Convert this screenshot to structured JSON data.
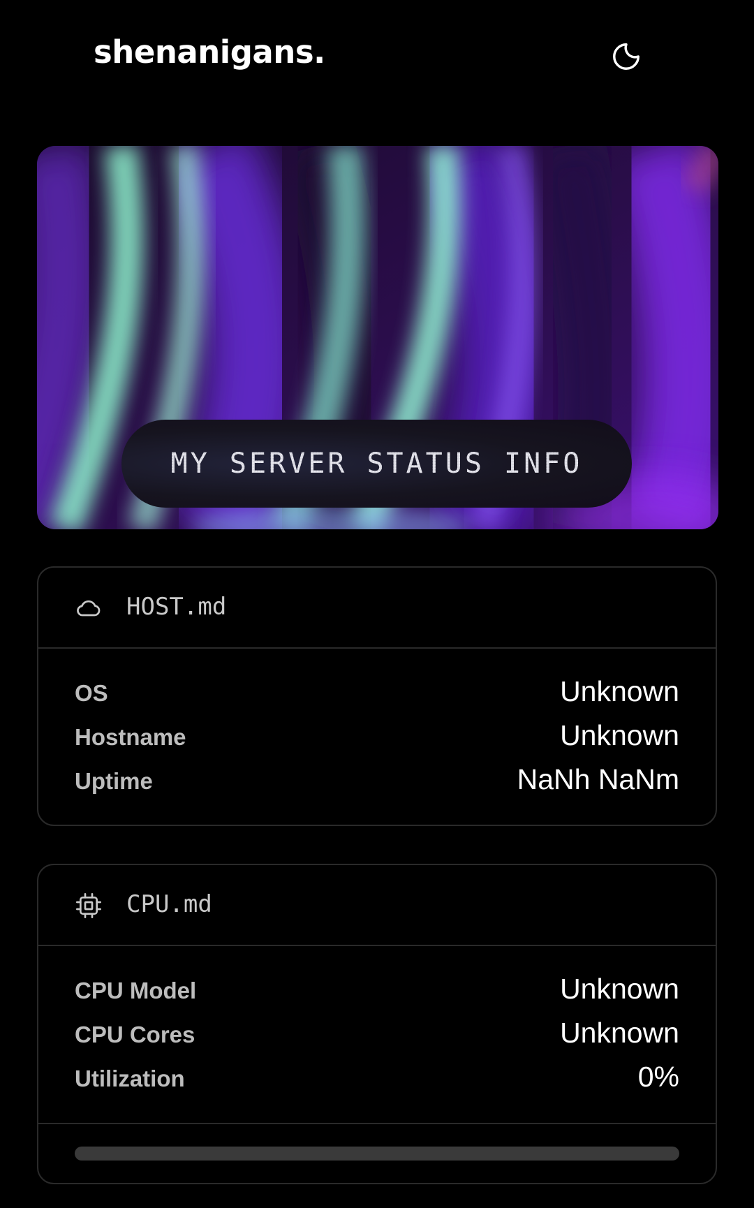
{
  "header": {
    "brand": "shenanigans.",
    "theme_icon": "moon-icon"
  },
  "hero": {
    "title": "MY SERVER STATUS INFO"
  },
  "host_card": {
    "icon": "cloud-icon",
    "title": "HOST.md",
    "rows": [
      {
        "label": "OS",
        "value": "Unknown"
      },
      {
        "label": "Hostname",
        "value": "Unknown"
      },
      {
        "label": "Uptime",
        "value": "NaNh NaNm"
      }
    ]
  },
  "cpu_card": {
    "icon": "cpu-chip-icon",
    "title": "CPU.md",
    "rows": [
      {
        "label": "CPU Model",
        "value": "Unknown"
      },
      {
        "label": "CPU Cores",
        "value": "Unknown"
      },
      {
        "label": "Utilization",
        "value": "0%"
      }
    ],
    "utilization_fraction": 0
  },
  "colors": {
    "background": "#000000",
    "card_border": "#2a2a2a",
    "label": "#bdbdbd",
    "value": "#ffffff",
    "progress_track": "#3a3a3a",
    "accent_mint": "#8ef5c8",
    "accent_purple": "#7b2ff0"
  }
}
